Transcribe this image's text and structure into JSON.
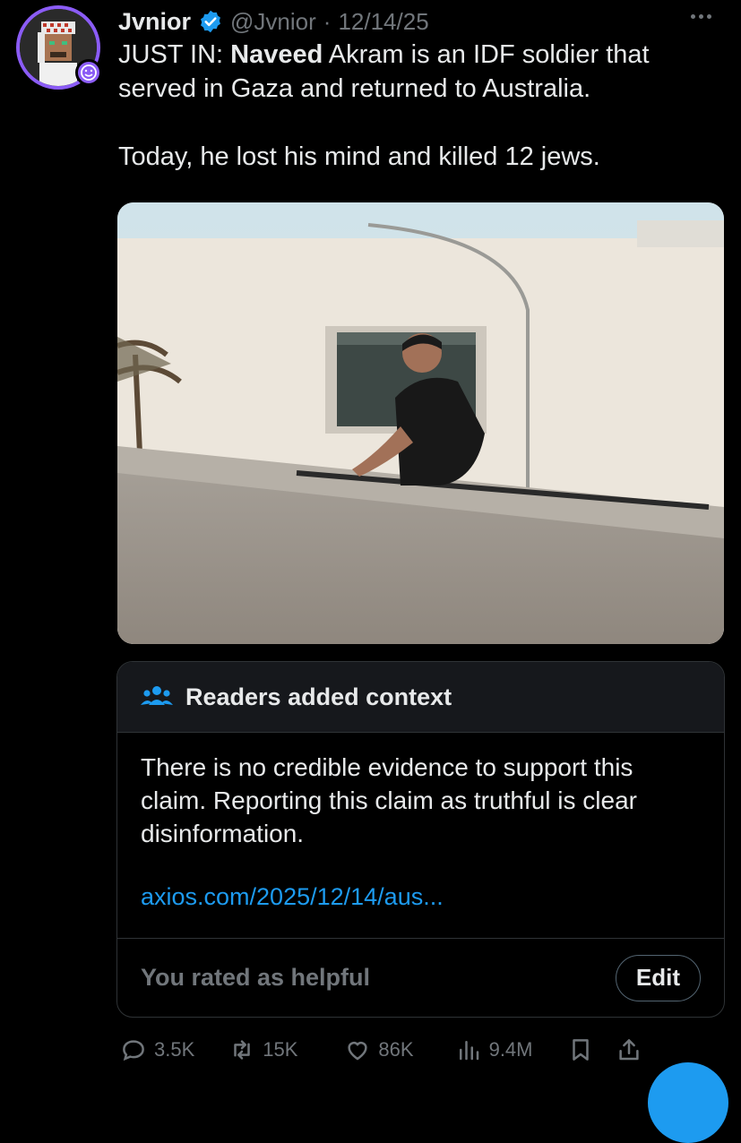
{
  "author": {
    "display_name": "Jvnior",
    "handle": "@Jvnior",
    "separator": "·",
    "date": "12/14/25"
  },
  "tweet": {
    "line1_prefix": "JUST IN: ",
    "line1_bold": "Naveed",
    "line1_rest": " Akram is an IDF soldier that served in Gaza and returned to Australia.",
    "line2": "Today, he lost his mind and killed 12 jews."
  },
  "community_note": {
    "title": "Readers added context",
    "body": "There is no credible evidence to support this claim. Reporting this claim as truthful is clear disinformation.",
    "link": "axios.com/2025/12/14/aus...",
    "rating_status": "You rated as helpful",
    "edit_label": "Edit"
  },
  "actions": {
    "replies": "3.5K",
    "reposts": "15K",
    "likes": "86K",
    "views": "9.4M"
  },
  "colors": {
    "background": "#000000",
    "text": "#e7e9ea",
    "muted": "#71767b",
    "link": "#1d9bf0",
    "avatar_ring": "#8b5cf6",
    "border": "#2f3336"
  }
}
